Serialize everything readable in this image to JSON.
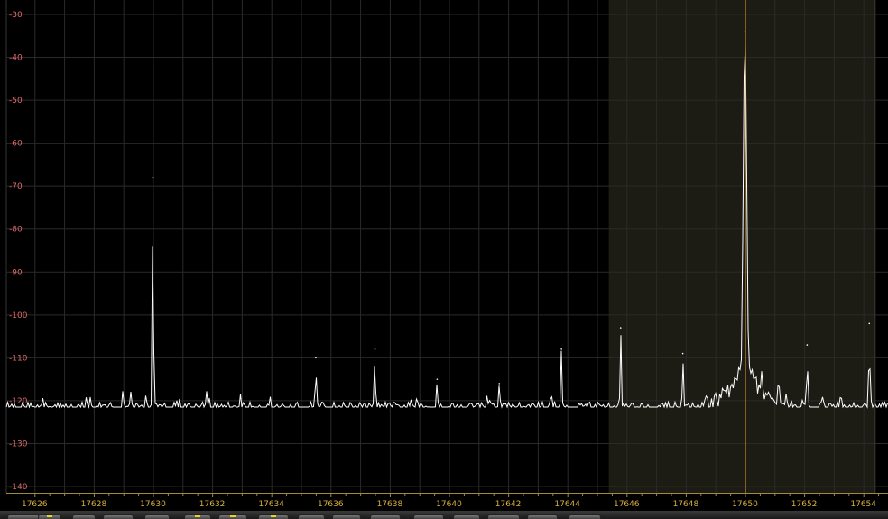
{
  "chart_data": {
    "type": "line",
    "xlabel": "",
    "ylabel": "",
    "xlim": [
      17625.5,
      17655.6
    ],
    "ylim": [
      -141,
      -29
    ],
    "y_ticks": [
      -30,
      -40,
      -50,
      -60,
      -70,
      -80,
      -90,
      -100,
      -110,
      -120,
      -130,
      -140
    ],
    "y_tick_labels": [
      "-30",
      "-40",
      "-50",
      "-60",
      "-70",
      "-80",
      "-90",
      "-100",
      "-110",
      "-120",
      "-130",
      "-140"
    ],
    "x_ticks": [
      17626,
      17628,
      17630,
      17632,
      17634,
      17636,
      17638,
      17640,
      17642,
      17644,
      17646,
      17648,
      17650,
      17652,
      17654
    ],
    "x_tick_labels": [
      "17626",
      "17628",
      "17630",
      "17632",
      "17634",
      "17636",
      "17638",
      "17640",
      "17642",
      "17644",
      "17646",
      "17648",
      "17650",
      "17652",
      "17654"
    ],
    "grid": true,
    "noise_floor": -121.5,
    "passband": [
      17645.4,
      17654.4
    ],
    "tuned_frequency": 17650.0,
    "series": [
      {
        "peaks": [
          {
            "x": 17630.0,
            "y": -68
          },
          {
            "x": 17635.5,
            "y": -110
          },
          {
            "x": 17637.5,
            "y": -108
          },
          {
            "x": 17639.6,
            "y": -115
          },
          {
            "x": 17641.7,
            "y": -116
          },
          {
            "x": 17643.8,
            "y": -108
          },
          {
            "x": 17645.8,
            "y": -103
          },
          {
            "x": 17647.9,
            "y": -109
          },
          {
            "x": 17650.0,
            "y": -34
          },
          {
            "x": 17652.1,
            "y": -107
          },
          {
            "x": 17654.2,
            "y": -102
          }
        ]
      }
    ],
    "colors": {
      "background": "#000000",
      "passband_fill": "#1c1c15",
      "grid": "#2a2a2a",
      "trace": "#ffffff",
      "tuning_line": "#e8a030",
      "y_tick_text": "#e06868",
      "x_tick_text": "#d8b040"
    }
  }
}
